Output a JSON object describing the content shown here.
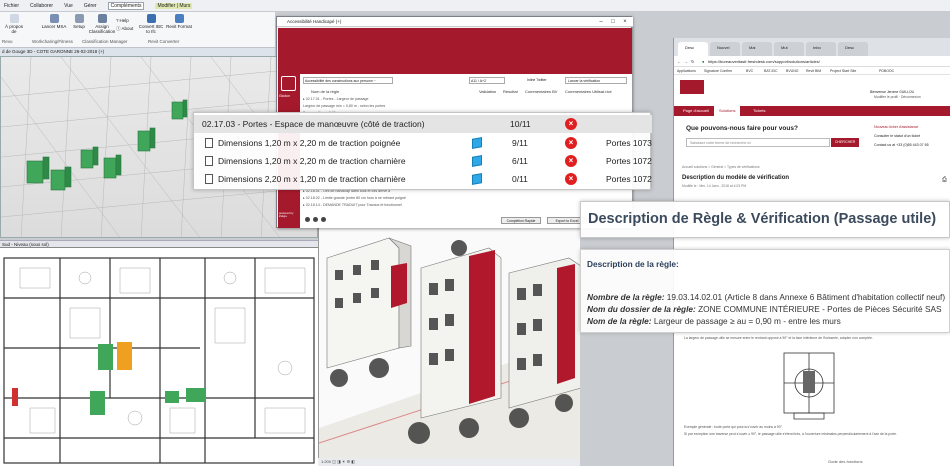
{
  "ribbon": {
    "tabs": [
      "Fichier",
      "Collaborer",
      "Vue",
      "Gérer",
      "Compléments",
      "Modifier | Murs"
    ],
    "buttons": [
      {
        "label": "À propos de"
      },
      {
        "label": "Lancer MSA"
      },
      {
        "label": "Setup"
      },
      {
        "label": "Assign Classification"
      },
      {
        "label": "Help"
      },
      {
        "label": "About"
      },
      {
        "label": "Convert IBC to Ifc"
      },
      {
        "label": "Revit Format"
      }
    ],
    "groups": [
      "Revu",
      "Workcharing/Fitness",
      "Classification Manager",
      "Revit Converter"
    ]
  },
  "view3d": {
    "title": "d de Gouge 3D - COTE GARONNE 26-02-2018 (+)"
  },
  "plan": {
    "title": "Sud - Niveau (sous sol)"
  },
  "dialog": {
    "title": "Accessibilité Handicapé (+)",
    "logo_label": "Glodon",
    "side_label": "powered by Zukga",
    "filter_left": "Accessibilité des constructions aux personn ~",
    "filter_mid": "A11 / A+2",
    "filter_right": "Lancer la vérification",
    "share": "Inline Twitter",
    "columns": [
      "Nom de la règle",
      "Validation",
      "Résultat",
      "Commentaires BV",
      "Commentaires Utilisat.rice"
    ],
    "rows": [
      "▸ 02.17.01 - Portes - Largeur de passage",
      "  Largeur de passage min = 0,80 m - selon les portes",
      "  Passage libre ≥ 0,80 m",
      "▸ 02.17.02 - Portes - Espace de manoeuvre (côté de poussée)",
      "  Dimensions 1,20 m x 2,20 m de traction poignée",
      "▸ 02.17.03 - Portes - Espace de manoeuvre",
      "  Dimensions 2,20 m x 1,20 m de traction charnière",
      "▸ 02.17.04 - Portes - Poignée de porte",
      "▸ 02.18.01 - Oeil de handicap dans tous et fois arrivé a",
      "▸ 02.18.02 - Limite grande (entre 80 cm hors à ne retirant poigné",
      "▸ 02.18.14 - DEMANDE TRADUIT pour Travaux et fonctionnel"
    ],
    "btn_completion": "Complétion Rapide",
    "btn_export": "Export to Excel"
  },
  "ruletable": {
    "header": {
      "label": "02.17.03 - Portes - Espace de manœuvre (côté de traction)",
      "count": "10/11"
    },
    "rows": [
      {
        "label": "Dimensions 1,20 m x 2,20 m de traction poignée",
        "count": "9/11",
        "elements": "Portes 1073"
      },
      {
        "label": "Dimensions 1,20 m x 2,20 m de traction charnière",
        "count": "6/11",
        "elements": "Portes 1072"
      },
      {
        "label": "Dimensions 2,20 m x 1,20 m de traction charnière",
        "count": "0/11",
        "elements": "Portes 1072"
      }
    ]
  },
  "browser": {
    "tabs": [
      "Desc",
      "Nouvel",
      "Mai",
      "Mut",
      "Inbo",
      "Desc"
    ],
    "address": "https://bureauveritasfr.freshdesk.com/support/solutions/articles/",
    "bookmarks": [
      "Applications",
      "Signature Confirm",
      "BVC",
      "BAT-IDC",
      "BVUNG",
      "Revit BIM",
      "Project Start Site",
      "PDBOOC"
    ],
    "user_line1": "Bienvenue Jerome GUILLOU",
    "user_line2": "Modifier le profil · Déconnexion",
    "nav": [
      "Page d'accueil",
      "Solutions",
      "Tickets"
    ],
    "help_title": "Que pouvons-nous faire pour vous?",
    "search_placeholder": "Saisissez votre terme de recherche ici",
    "search_button": "CHERCHER",
    "links": [
      "Nouveau ticket d'assistance",
      "Consulter le statut d'un ticket",
      "Contact us at +33 (0)55 443 07 65"
    ],
    "crumbs": "Accueil solutions  >  Général  >  Types de vérifications",
    "article_title": "Description du modèle de vérification",
    "article_meta": "Modifié le : Mer, 14 Janv., 2018 at 4:03 PM"
  },
  "description": {
    "title": "Description de Règle & Vérification (Passage utile)",
    "section": "Description de la règle:",
    "lines": [
      {
        "key": "Nombre de la règle:",
        "value": " 19.03.14.02.01 (Article 8 dans Annexe 6 Bâtiment d'habitation collectif neuf)"
      },
      {
        "key": "Nom du dossier de la règle:",
        "value": " ZONE COMMUNE INTÉRIEURE - Portes de Pièces Sécurité SAS"
      },
      {
        "key": "Nom de la règle:",
        "value": " Largeur de passage ≥ au = 0,90 m - entre les murs"
      }
    ],
    "fine1": "La largeur de passage utile se mesure entre le rentrant opposé à 90° et la face intérieure de l'huisserie, adopter non comptée.",
    "fine2": "Exemple générale : toute porte qui pourra s'ouvrir au moins à 90°.",
    "fine3": "Si par exception une traverse peut s'ouvrir ≥ 90°, le passage utile s'étend très, à l'ouverture minimales perpendiculairement à l'axe de la porte.",
    "footer": "Gode des fonctions"
  },
  "midview": {
    "status": "1:200  ◫ ◨ ☀ ⚙ ◧"
  }
}
